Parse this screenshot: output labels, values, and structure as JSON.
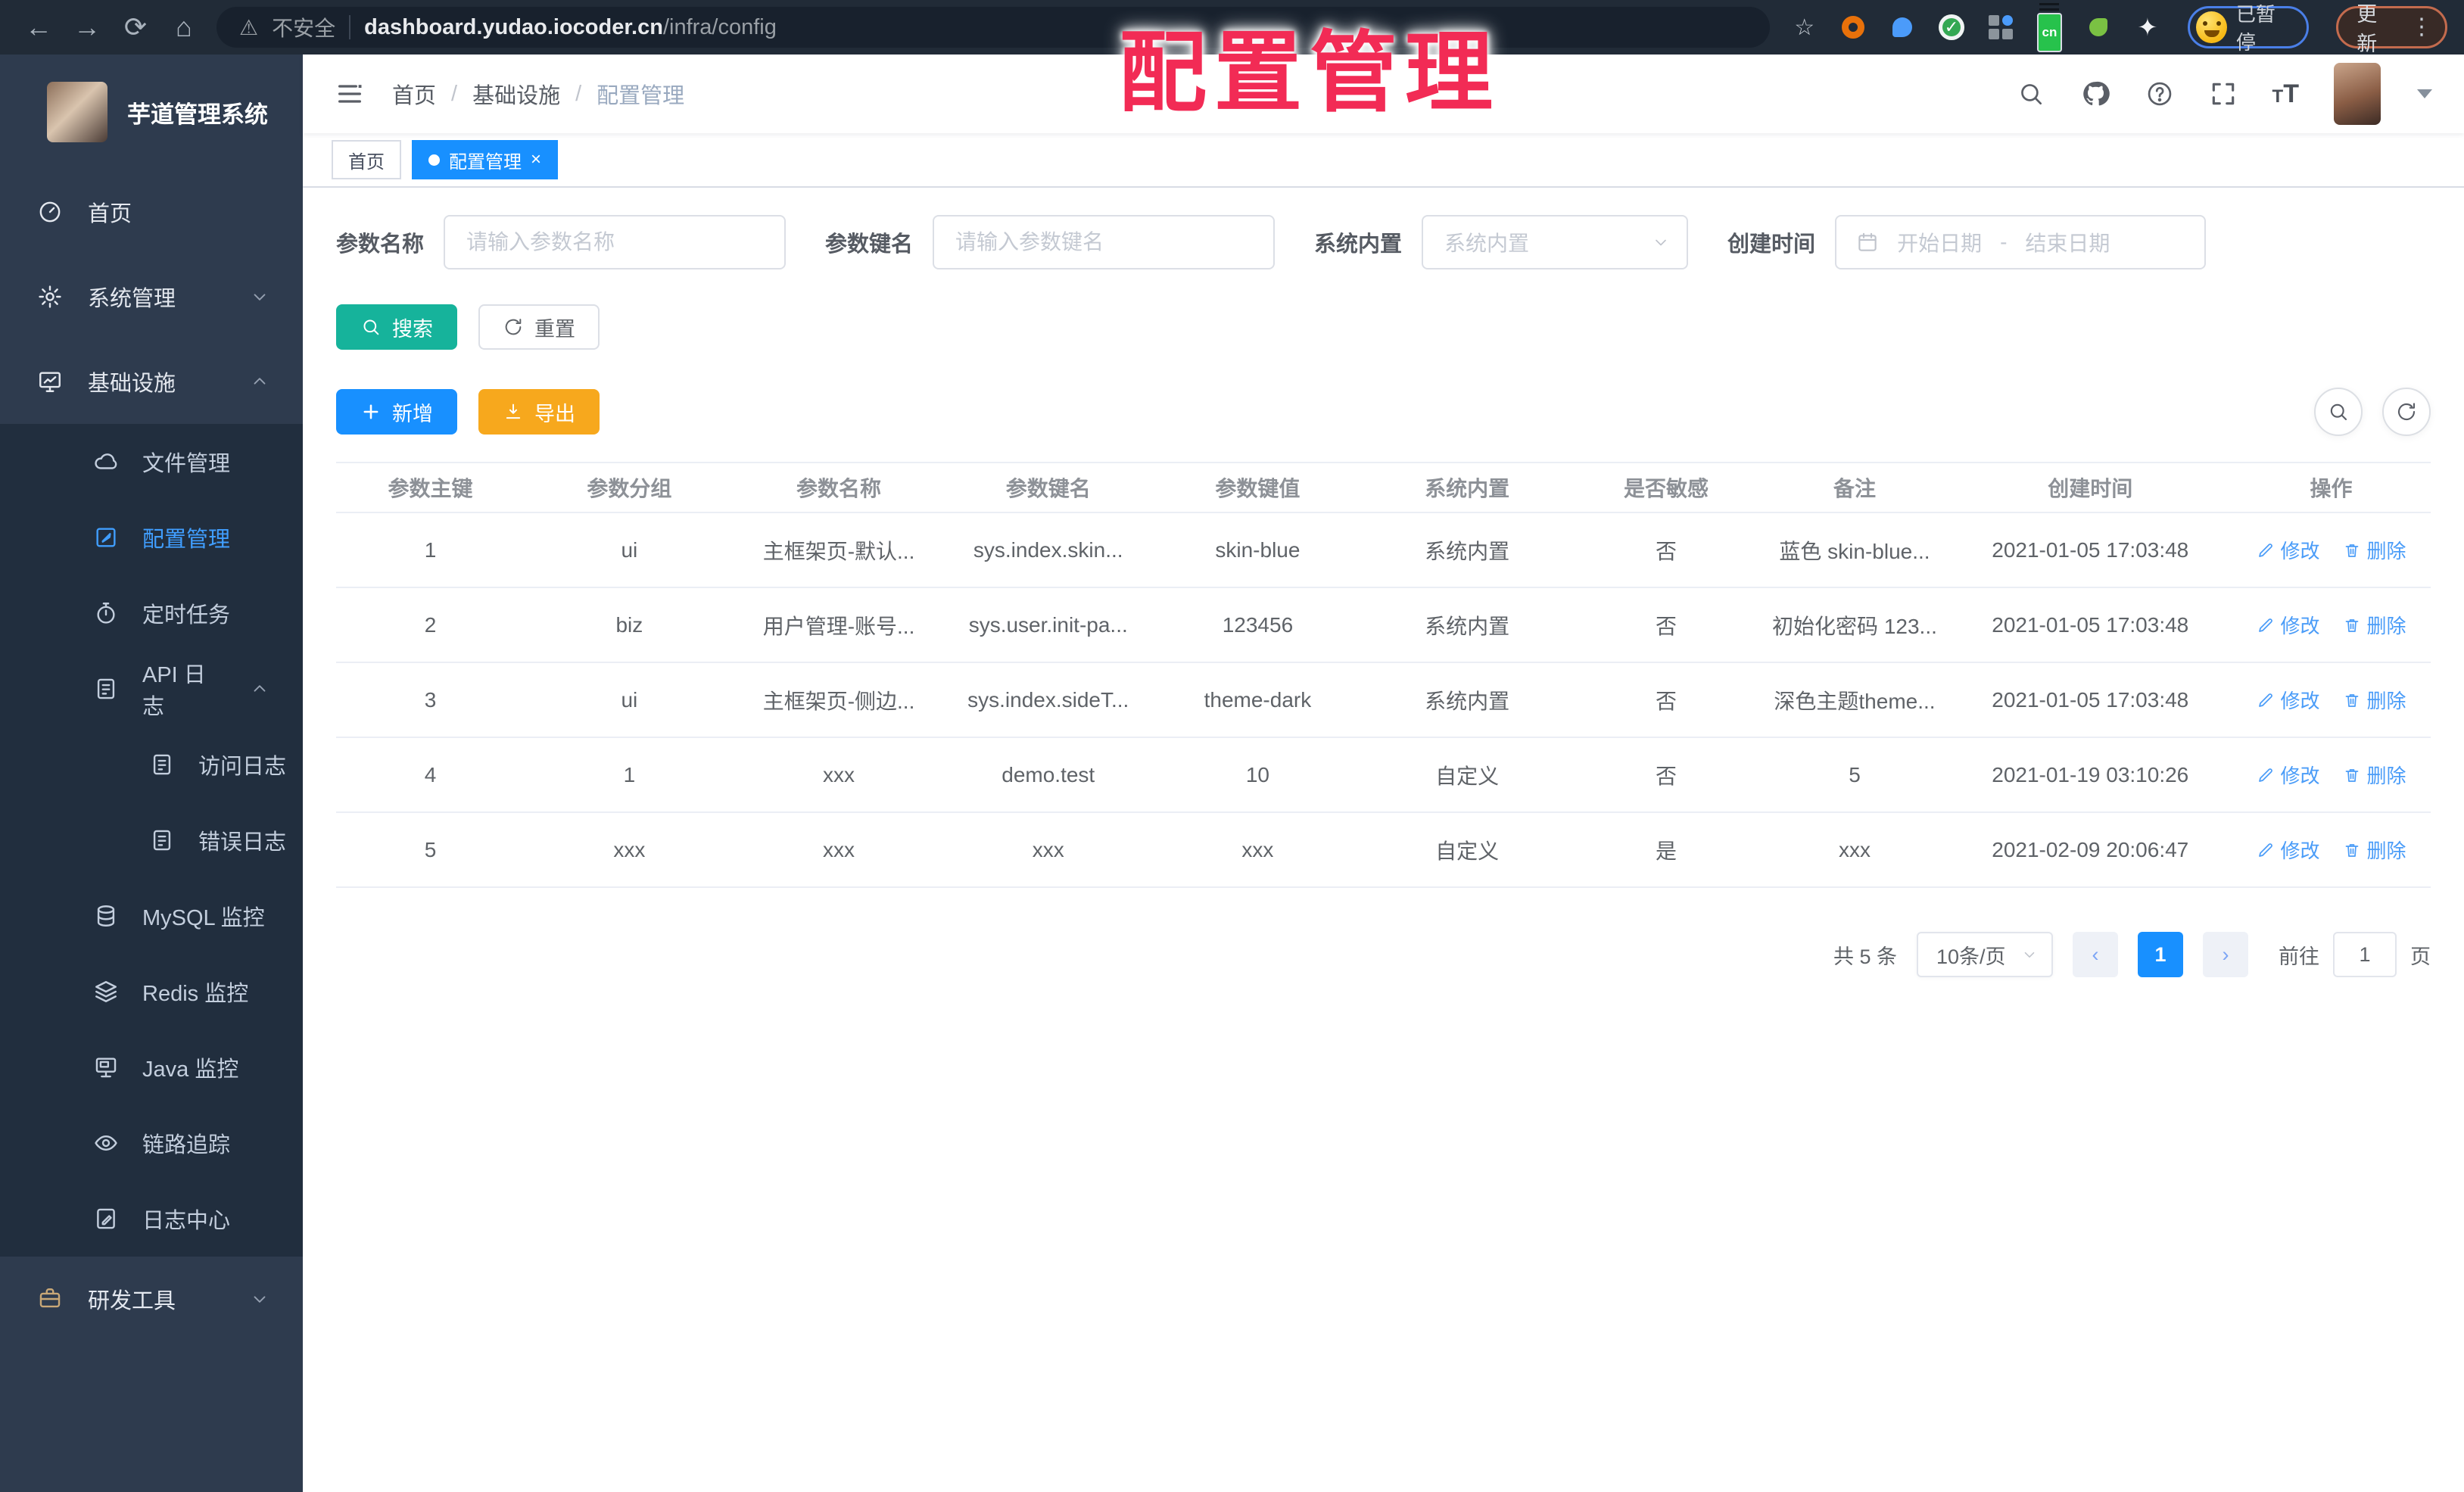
{
  "browser": {
    "security_label": "不安全",
    "url_domain": "dashboard.yudao.iocoder.cn",
    "url_path": "/infra/config",
    "profile_status": "已暂停",
    "update_label": "更新",
    "menu_dots": "⋮",
    "back": "←",
    "forward": "→",
    "reload": "⟳",
    "home": "⌂",
    "warning": "⚠",
    "star": "☆",
    "check": "✓",
    "sparkle": "✦",
    "cn_badge": "cn"
  },
  "overlay": {
    "title": "配置管理",
    "color": "#f22b55"
  },
  "sidebar": {
    "app_title": "芋道管理系统",
    "items": [
      {
        "label": "首页"
      },
      {
        "label": "系统管理"
      },
      {
        "label": "基础设施"
      },
      {
        "label": "文件管理"
      },
      {
        "label": "配置管理"
      },
      {
        "label": "定时任务"
      },
      {
        "label": "API 日志"
      },
      {
        "label": "访问日志"
      },
      {
        "label": "错误日志"
      },
      {
        "label": "MySQL 监控"
      },
      {
        "label": "Redis 监控"
      },
      {
        "label": "Java 监控"
      },
      {
        "label": "链路追踪"
      },
      {
        "label": "日志中心"
      },
      {
        "label": "研发工具"
      }
    ]
  },
  "navbar": {
    "breadcrumb": {
      "0": "首页",
      "1": "基础设施",
      "2": "配置管理"
    },
    "separator": "/"
  },
  "tags": {
    "home": "首页",
    "current": "配置管理",
    "close": "×"
  },
  "filters": {
    "name_label": "参数名称",
    "name_placeholder": "请输入参数名称",
    "key_label": "参数键名",
    "key_placeholder": "请输入参数键名",
    "builtin_label": "系统内置",
    "builtin_placeholder": "系统内置",
    "time_label": "创建时间",
    "start_placeholder": "开始日期",
    "range_separator": "-",
    "end_placeholder": "结束日期",
    "search_label": "搜索",
    "reset_label": "重置",
    "add_label": "新增",
    "export_label": "导出"
  },
  "table": {
    "headers": {
      "0": "参数主键",
      "1": "参数分组",
      "2": "参数名称",
      "3": "参数键名",
      "4": "参数键值",
      "5": "系统内置",
      "6": "是否敏感",
      "7": "备注",
      "8": "创建时间",
      "9": "操作"
    },
    "edit_label": "修改",
    "delete_label": "删除",
    "rows": [
      {
        "id": "1",
        "group": "ui",
        "name": "主框架页-默认...",
        "key": "sys.index.skin...",
        "value": "skin-blue",
        "builtin": "系统内置",
        "sensitive": "否",
        "remark": "蓝色 skin-blue...",
        "created": "2021-01-05 17:03:48"
      },
      {
        "id": "2",
        "group": "biz",
        "name": "用户管理-账号...",
        "key": "sys.user.init-pa...",
        "value": "123456",
        "builtin": "系统内置",
        "sensitive": "否",
        "remark": "初始化密码 123...",
        "created": "2021-01-05 17:03:48"
      },
      {
        "id": "3",
        "group": "ui",
        "name": "主框架页-侧边...",
        "key": "sys.index.sideT...",
        "value": "theme-dark",
        "builtin": "系统内置",
        "sensitive": "否",
        "remark": "深色主题theme...",
        "created": "2021-01-05 17:03:48"
      },
      {
        "id": "4",
        "group": "1",
        "name": "xxx",
        "key": "demo.test",
        "value": "10",
        "builtin": "自定义",
        "sensitive": "否",
        "remark": "5",
        "created": "2021-01-19 03:10:26"
      },
      {
        "id": "5",
        "group": "xxx",
        "name": "xxx",
        "key": "xxx",
        "value": "xxx",
        "builtin": "自定义",
        "sensitive": "是",
        "remark": "xxx",
        "created": "2021-02-09 20:06:47"
      }
    ]
  },
  "pagination": {
    "total": "共 5 条",
    "page_size": "10条/页",
    "prev": "‹",
    "next": "›",
    "current": "1",
    "jump_prefix": "前往",
    "jump_value": "1",
    "jump_suffix": "页"
  },
  "colors": {
    "accent": "#1890ff",
    "sidebar_bg": "#2e3b4e",
    "submenu_bg": "#212e3e",
    "active_link": "#409eff",
    "search_btn": "#16b39b",
    "export_btn": "#f7a81d",
    "overlay_red": "#f22b55"
  }
}
